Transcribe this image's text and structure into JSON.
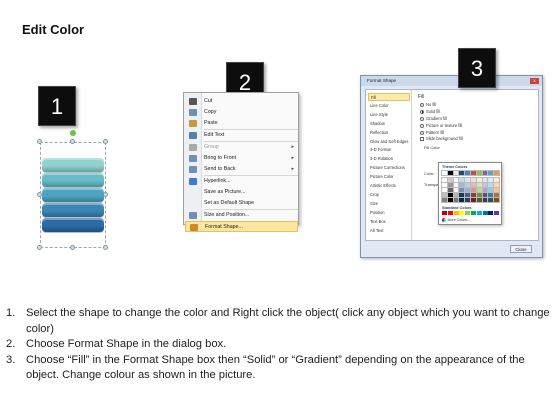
{
  "title": "Edit Color",
  "badges": [
    "1",
    "2",
    "3"
  ],
  "shape_colors": [
    "#2b6ba7",
    "#3a87b6",
    "#4da3c4",
    "#66bdc9",
    "#8fd3cf"
  ],
  "context_menu": {
    "items": [
      {
        "label": "Cut",
        "disabled": false,
        "submenu": false,
        "icon": "scissors-icon"
      },
      {
        "label": "Copy",
        "disabled": false,
        "submenu": false,
        "icon": "copy-icon"
      },
      {
        "label": "Paste",
        "disabled": false,
        "submenu": false,
        "icon": "paste-icon"
      },
      {
        "label": "Edit Text",
        "disabled": false,
        "submenu": false,
        "icon": "edit-text-icon"
      },
      {
        "label": "Group",
        "disabled": true,
        "submenu": true,
        "icon": "group-icon"
      },
      {
        "label": "Bring to Front",
        "disabled": false,
        "submenu": true,
        "icon": "bring-front-icon"
      },
      {
        "label": "Send to Back",
        "disabled": false,
        "submenu": true,
        "icon": "send-back-icon"
      },
      {
        "label": "Hyperlink...",
        "disabled": false,
        "submenu": false,
        "icon": "hyperlink-icon"
      },
      {
        "label": "Save as Picture...",
        "disabled": false,
        "submenu": false,
        "icon": ""
      },
      {
        "label": "Set as Default Shape",
        "disabled": false,
        "submenu": false,
        "icon": ""
      },
      {
        "label": "Size and Position...",
        "disabled": false,
        "submenu": false,
        "icon": "size-position-icon"
      },
      {
        "label": "Format Shape...",
        "disabled": false,
        "submenu": false,
        "icon": "format-shape-icon",
        "highlighted": true
      }
    ]
  },
  "dialog": {
    "title": "Format Shape",
    "close_x": "x",
    "nav": [
      "Fill",
      "Line Color",
      "Line Style",
      "Shadow",
      "Reflection",
      "Glow and Soft Edges",
      "3-D Format",
      "3-D Rotation",
      "Picture Corrections",
      "Picture Color",
      "Artistic Effects",
      "Crop",
      "Size",
      "Position",
      "Text Box",
      "Alt Text"
    ],
    "selected_nav": "Fill",
    "fill_heading": "Fill",
    "options": [
      {
        "label": "No fill",
        "checked": false
      },
      {
        "label": "Solid fill",
        "checked": true
      },
      {
        "label": "Gradient fill",
        "checked": false
      },
      {
        "label": "Picture or texture fill",
        "checked": false
      },
      {
        "label": "Pattern fill",
        "checked": false
      }
    ],
    "slide_bg_label": "Slide background fill",
    "fill_color_label": "Fill Color",
    "color_label": "Color:",
    "transparency_label": "Transpa",
    "close_button": "Close"
  },
  "palette": {
    "theme_header": "Theme Colors",
    "standard_header": "Standard Colors",
    "more_label": "More Colors...",
    "theme_top": [
      "#ffffff",
      "#000000",
      "#eeece1",
      "#1f497d",
      "#4f81bd",
      "#c0504d",
      "#9bbb59",
      "#8064a2",
      "#4bacc6",
      "#f79646"
    ],
    "standard": [
      "#c00000",
      "#ff0000",
      "#ffc000",
      "#ffff00",
      "#92d050",
      "#00b050",
      "#00b0f0",
      "#0070c0",
      "#002060",
      "#7030a0"
    ]
  },
  "instructions": [
    {
      "num": "1.",
      "text": "Select the shape to change the color and Right click the object( click any object which you want to change color)"
    },
    {
      "num": "2.",
      "text": "Choose Format Shape in the dialog box."
    },
    {
      "num": "3.",
      "text": "Choose “Fill” in the Format Shape box then “Solid” or “Gradient” depending on the appearance of the object. Change colour as shown in the picture."
    }
  ]
}
